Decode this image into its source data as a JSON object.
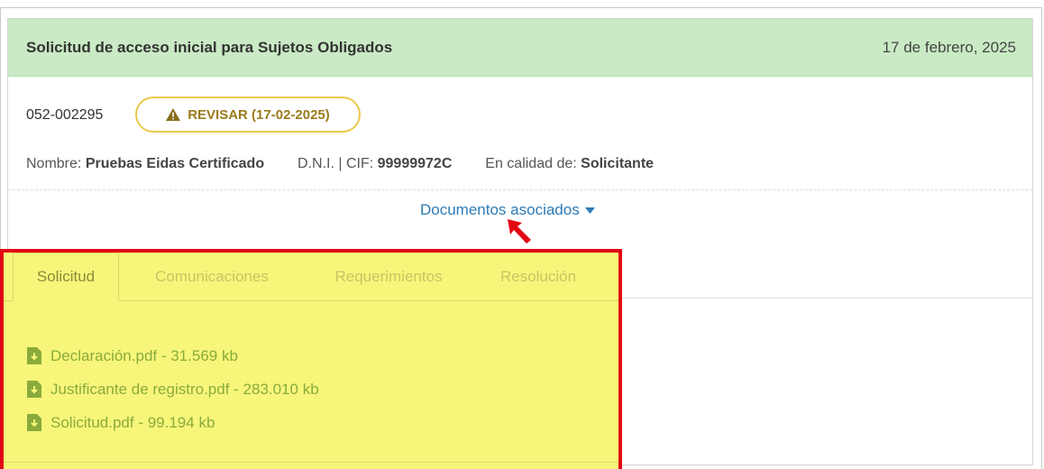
{
  "header": {
    "title": "Solicitud de acceso inicial para Sujetos Obligados",
    "date": "17 de febrero, 2025"
  },
  "record": {
    "id": "052-002295",
    "status_label": "REVISAR (17-02-2025)",
    "status_icon": "warning-icon",
    "name_label": "Nombre:",
    "name_value": "Pruebas Eidas Certificado",
    "dni_label": "D.N.I. | CIF:",
    "dni_value": "99999972C",
    "role_label": "En calidad de:",
    "role_value": "Solicitante"
  },
  "docs_toggle": {
    "label": "Documentos asociados",
    "icon": "caret-down-icon"
  },
  "tabs": [
    {
      "label": "Solicitud",
      "active": true
    },
    {
      "label": "Comunicaciones",
      "active": false
    },
    {
      "label": "Requerimientos",
      "active": false
    },
    {
      "label": "Resolución",
      "active": false
    }
  ],
  "files": [
    {
      "label": "Declaración.pdf - 31.569 kb",
      "icon": "file-download-icon"
    },
    {
      "label": "Justificante de registro.pdf - 283.010 kb",
      "icon": "file-download-icon"
    },
    {
      "label": "Solicitud.pdf - 99.194 kb",
      "icon": "file-download-icon"
    }
  ],
  "colors": {
    "header_bg": "#c9eac4",
    "badge_border": "#e8c84a",
    "link": "#2d7bb5",
    "highlight_bg": "#f7f67a",
    "highlight_border": "#e30613",
    "file_text": "#8aab3c"
  }
}
